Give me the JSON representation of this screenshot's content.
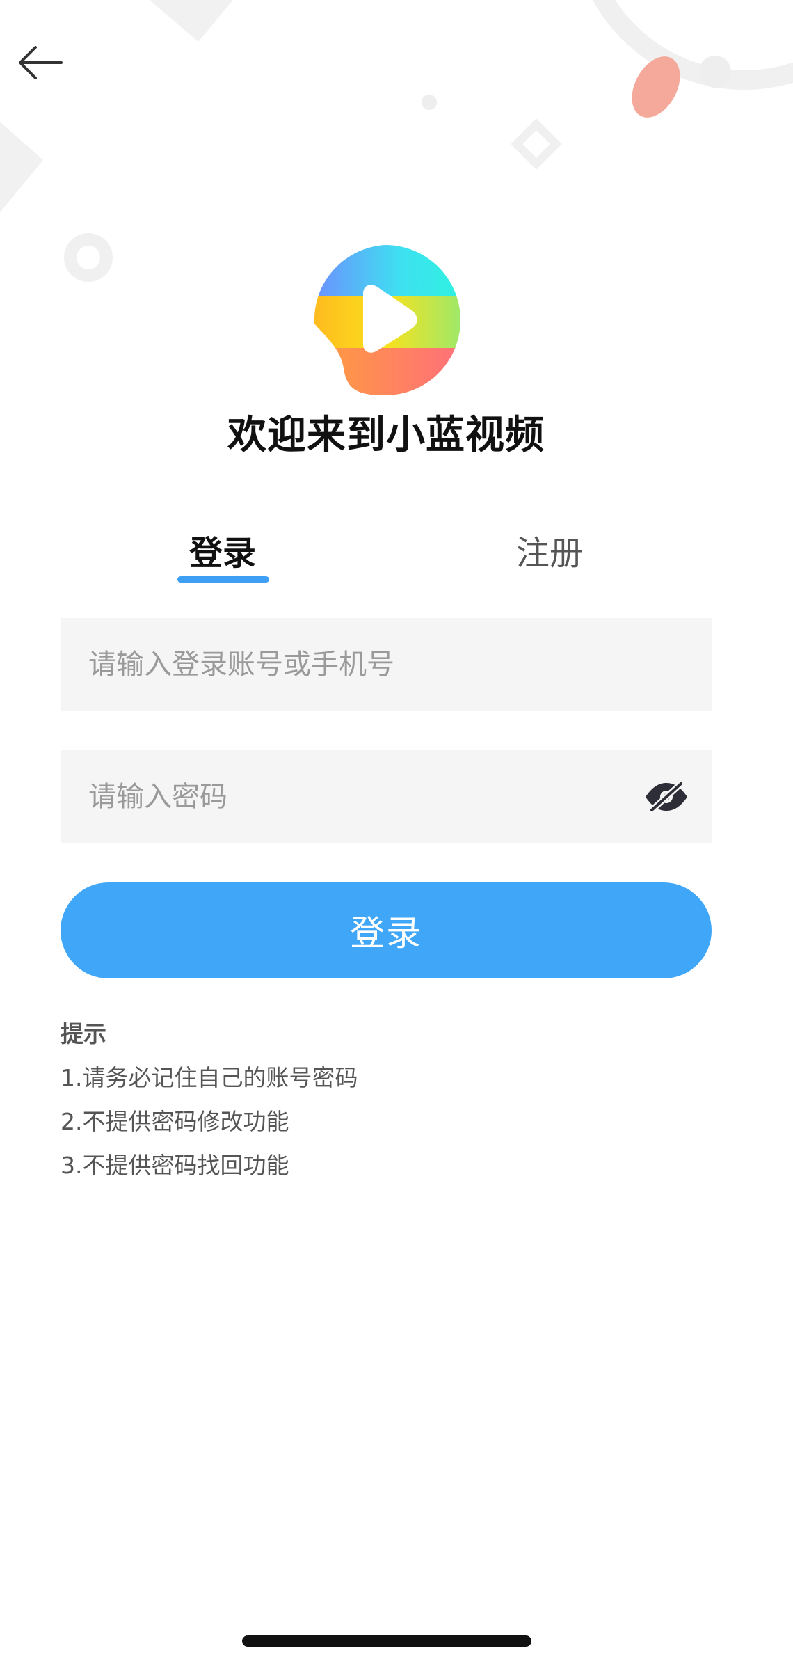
{
  "header": {
    "back_icon": "arrow-left-icon"
  },
  "brand": {
    "logo_icon": "rainbow-play-logo",
    "title": "欢迎来到小蓝视频"
  },
  "tabs": [
    {
      "label": "登录",
      "active": true
    },
    {
      "label": "注册",
      "active": false
    }
  ],
  "form": {
    "account_placeholder": "请输入登录账号或手机号",
    "account_value": "",
    "password_placeholder": "请输入密码",
    "password_value": "",
    "password_toggle_icon": "eye-slash-icon",
    "submit_label": "登录"
  },
  "tips": {
    "title": "提示",
    "items": [
      "1.请务必记住自己的账号密码",
      "2.不提供密码修改功能",
      "3.不提供密码找回功能"
    ]
  },
  "colors": {
    "accent": "#3fa6f8",
    "tab_underline": "#3f9ff5",
    "field_background": "#f5f5f5",
    "decor_gray": "#f0f0f0",
    "decor_salmon": "#f5a99b"
  }
}
